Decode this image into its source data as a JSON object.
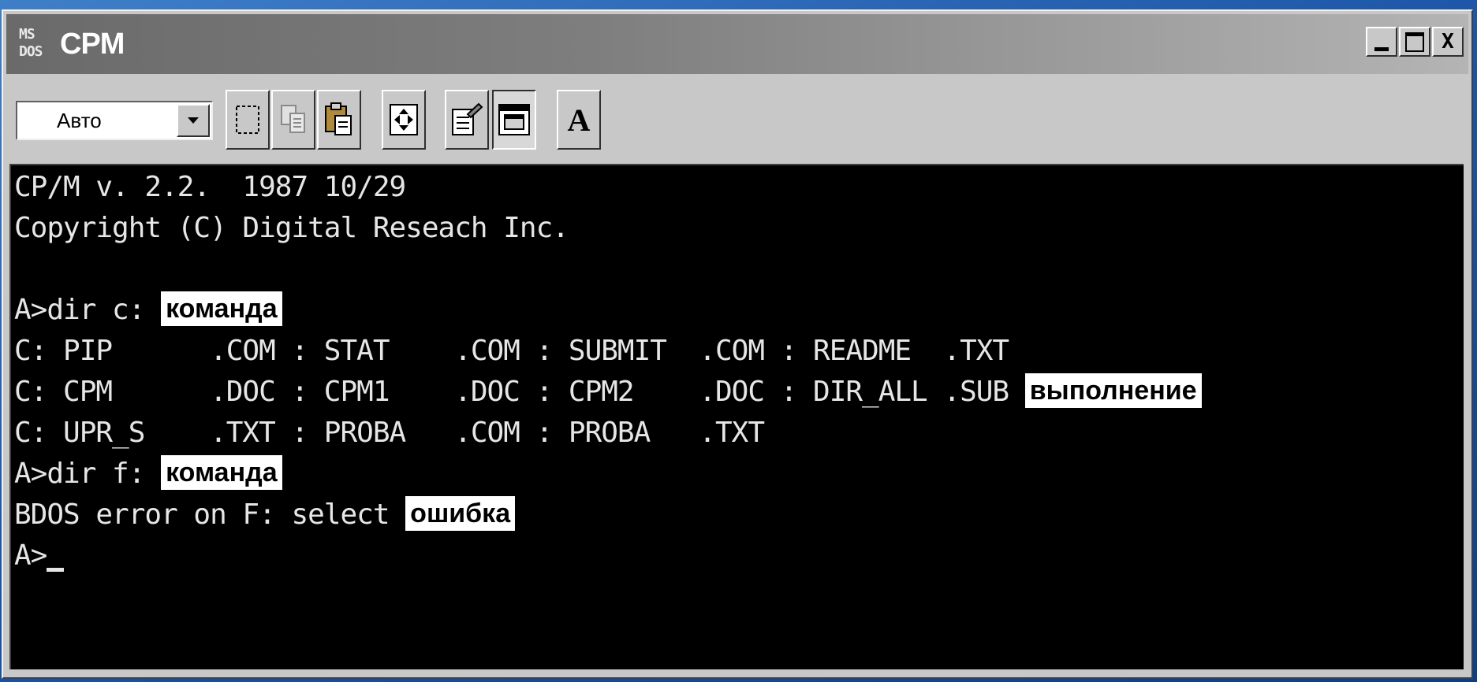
{
  "window": {
    "title": "CPM",
    "icon_text_top": "MS",
    "icon_text_bottom": "DOS",
    "controls": [
      "minimize-icon",
      "maximize-icon",
      "close-icon"
    ],
    "close_glyph": "X"
  },
  "toolbar": {
    "font_size_value": "Авто",
    "buttons": [
      "mark-icon",
      "copy-icon",
      "paste-icon",
      "fullscreen-icon",
      "properties-icon",
      "background-icon",
      "font-icon"
    ],
    "font_button_label": "A"
  },
  "console": {
    "lines": [
      "CP/M v. 2.2.  1987 10/29",
      "Copyright (C) Digital Reseach Inc.",
      "",
      "A>dir c: ",
      "C: PIP      .COM : STAT    .COM : SUBMIT  .COM : README  .TXT",
      "C: CPM      .DOC : CPM1    .DOC : CPM2    .DOC : DIR_ALL .SUB ",
      "C: UPR_S    .TXT : PROBA   .COM : PROBA   .TXT",
      "A>dir f: ",
      "BDOS error on F: select ",
      "A>"
    ],
    "labels": {
      "command_1": "команда",
      "execution": "выполнение",
      "command_2": "команда",
      "error": "ошибка"
    }
  },
  "colors": {
    "console_bg": "#000000",
    "console_text": "#e6e6e6",
    "label_bg": "#ffffff",
    "desktop": "#1d56a8"
  }
}
